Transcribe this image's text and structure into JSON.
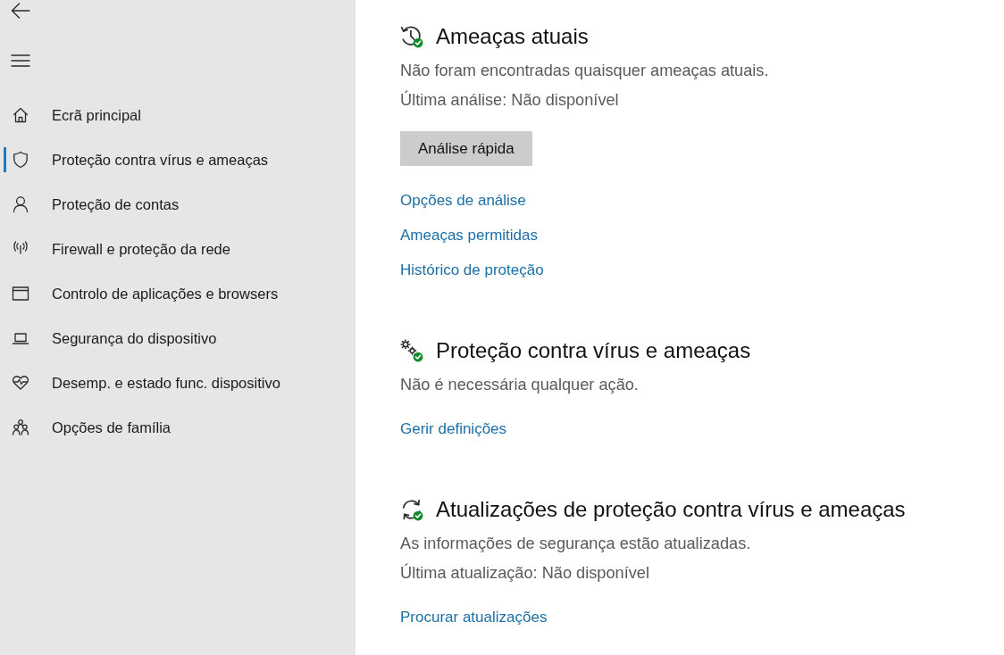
{
  "sidebar": {
    "items": [
      {
        "label": "Ecrã principal",
        "selected": false
      },
      {
        "label": "Proteção contra vírus e ameaças",
        "selected": true
      },
      {
        "label": "Proteção de contas",
        "selected": false
      },
      {
        "label": "Firewall e proteção da rede",
        "selected": false
      },
      {
        "label": "Controlo de aplicações e browsers",
        "selected": false
      },
      {
        "label": "Segurança do dispositivo",
        "selected": false
      },
      {
        "label": "Desemp. e estado func. dispositivo",
        "selected": false
      },
      {
        "label": "Opções de família",
        "selected": false
      }
    ]
  },
  "sections": [
    {
      "title": "Ameaças atuais",
      "lines": [
        "Não foram encontradas quaisquer ameaças atuais.",
        "Última análise: Não disponível"
      ],
      "button": "Análise rápida",
      "links": [
        "Opções de análise",
        "Ameaças permitidas",
        "Histórico de proteção"
      ]
    },
    {
      "title": "Proteção contra vírus e ameaças",
      "lines": [
        "Não é necessária qualquer ação."
      ],
      "links": [
        "Gerir definições"
      ]
    },
    {
      "title": "Atualizações de proteção contra vírus e ameaças",
      "lines": [
        "As informações de segurança estão atualizadas.",
        "Última atualização: Não disponível"
      ],
      "links": [
        "Procurar atualizações"
      ]
    }
  ]
}
